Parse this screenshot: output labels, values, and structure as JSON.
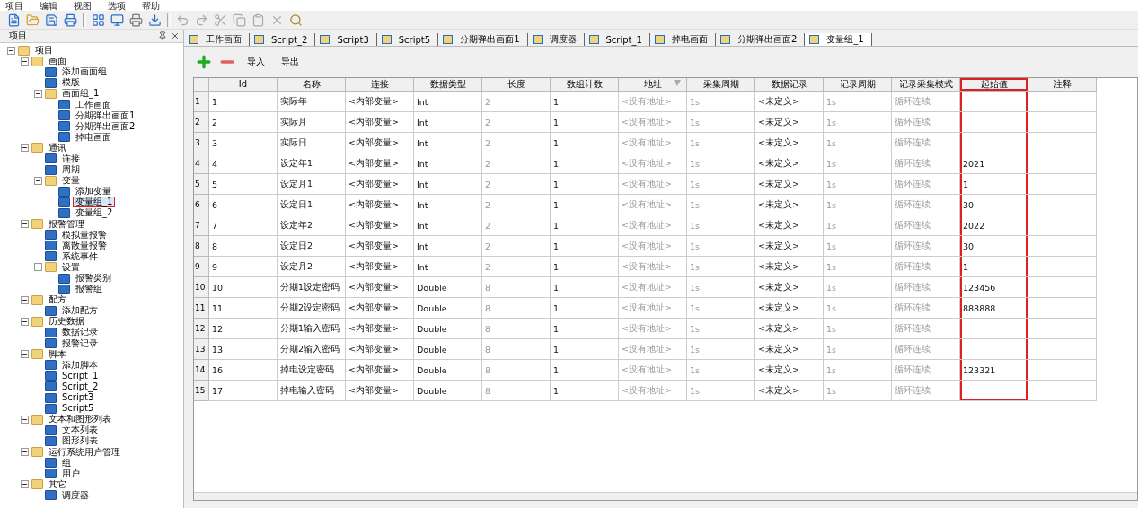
{
  "menu": [
    "项目",
    "编辑",
    "视图",
    "选项",
    "帮助"
  ],
  "sidebar": {
    "title": "项目",
    "tree": [
      {
        "label": "项目",
        "expanded": true,
        "selected": false,
        "children": [
          {
            "label": "画面",
            "expanded": true,
            "selected": false,
            "children": [
              {
                "label": "添加画面组",
                "selected": false
              },
              {
                "label": "模版",
                "selected": false
              },
              {
                "label": "画面组_1",
                "expanded": true,
                "selected": false,
                "children": [
                  {
                    "label": "工作画面",
                    "selected": false
                  },
                  {
                    "label": "分期弹出画面1",
                    "selected": false
                  },
                  {
                    "label": "分期弹出画面2",
                    "selected": false
                  },
                  {
                    "label": "掉电画面",
                    "selected": false
                  }
                ]
              }
            ]
          },
          {
            "label": "通讯",
            "expanded": true,
            "selected": false,
            "children": [
              {
                "label": "连接",
                "selected": false
              },
              {
                "label": "周期",
                "selected": false
              },
              {
                "label": "变量",
                "expanded": true,
                "selected": false,
                "children": [
                  {
                    "label": "添加变量",
                    "selected": false
                  },
                  {
                    "label": "变量组_1",
                    "selected": true,
                    "annotated": true
                  },
                  {
                    "label": "变量组_2",
                    "selected": false
                  }
                ]
              }
            ]
          },
          {
            "label": "报警管理",
            "expanded": true,
            "selected": false,
            "children": [
              {
                "label": "模拟量报警",
                "selected": false
              },
              {
                "label": "离散量报警",
                "selected": false
              },
              {
                "label": "系统事件",
                "selected": false
              },
              {
                "label": "设置",
                "expanded": true,
                "selected": false,
                "children": [
                  {
                    "label": "报警类别",
                    "selected": false
                  },
                  {
                    "label": "报警组",
                    "selected": false
                  }
                ]
              }
            ]
          },
          {
            "label": "配方",
            "expanded": true,
            "selected": false,
            "children": [
              {
                "label": "添加配方",
                "selected": false
              }
            ]
          },
          {
            "label": "历史数据",
            "expanded": true,
            "selected": false,
            "children": [
              {
                "label": "数据记录",
                "selected": false
              },
              {
                "label": "报警记录",
                "selected": false
              }
            ]
          },
          {
            "label": "脚本",
            "expanded": true,
            "selected": false,
            "children": [
              {
                "label": "添加脚本",
                "selected": false
              },
              {
                "label": "Script_1",
                "selected": false
              },
              {
                "label": "Script_2",
                "selected": false
              },
              {
                "label": "Script3",
                "selected": false
              },
              {
                "label": "Script5",
                "selected": false
              }
            ]
          },
          {
            "label": "文本和图形列表",
            "expanded": true,
            "selected": false,
            "children": [
              {
                "label": "文本列表",
                "selected": false
              },
              {
                "label": "图形列表",
                "selected": false
              }
            ]
          },
          {
            "label": "运行系统用户管理",
            "expanded": true,
            "selected": false,
            "children": [
              {
                "label": "组",
                "selected": false
              },
              {
                "label": "用户",
                "selected": false
              }
            ]
          },
          {
            "label": "其它",
            "expanded": true,
            "selected": false,
            "children": [
              {
                "label": "调度器",
                "selected": false
              }
            ]
          }
        ]
      }
    ]
  },
  "tabs": [
    {
      "label": "工作画面",
      "selected": false
    },
    {
      "label": "Script_2",
      "selected": false
    },
    {
      "label": "Script3",
      "selected": false
    },
    {
      "label": "Script5",
      "selected": false
    },
    {
      "label": "分期弹出画面1",
      "selected": false
    },
    {
      "label": "调度器",
      "selected": false
    },
    {
      "label": "Script_1",
      "selected": false
    },
    {
      "label": "掉电画面",
      "selected": false
    },
    {
      "label": "分期弹出画面2",
      "selected": false
    },
    {
      "label": "变量组_1",
      "selected": true
    }
  ],
  "actions": [
    "导入",
    "导出"
  ],
  "table": {
    "columns": [
      {
        "label": "Id",
        "muted": false,
        "annotated": false
      },
      {
        "label": "名称",
        "muted": false,
        "annotated": false
      },
      {
        "label": "连接",
        "muted": false,
        "annotated": false
      },
      {
        "label": "数据类型",
        "muted": false,
        "annotated": false
      },
      {
        "label": "长度",
        "muted": true,
        "annotated": false
      },
      {
        "label": "数组计数",
        "muted": false,
        "annotated": false
      },
      {
        "label": "地址",
        "muted": true,
        "annotated": false,
        "filter": true
      },
      {
        "label": "采集周期",
        "muted": true,
        "annotated": false
      },
      {
        "label": "数据记录",
        "muted": false,
        "annotated": false
      },
      {
        "label": "记录周期",
        "muted": true,
        "annotated": false
      },
      {
        "label": "记录采集模式",
        "muted": true,
        "annotated": false
      },
      {
        "label": "起始值",
        "muted": false,
        "annotated": true
      },
      {
        "label": "注释",
        "muted": false,
        "annotated": false
      }
    ],
    "rows": [
      {
        "num": "1",
        "cells": [
          "1",
          "实际年",
          "<内部变量>",
          "Int",
          "2",
          "1",
          "<没有地址>",
          "1s",
          "<未定义>",
          "1s",
          "循环连续",
          "",
          ""
        ]
      },
      {
        "num": "2",
        "cells": [
          "2",
          "实际月",
          "<内部变量>",
          "Int",
          "2",
          "1",
          "<没有地址>",
          "1s",
          "<未定义>",
          "1s",
          "循环连续",
          "",
          ""
        ]
      },
      {
        "num": "3",
        "cells": [
          "3",
          "实际日",
          "<内部变量>",
          "Int",
          "2",
          "1",
          "<没有地址>",
          "1s",
          "<未定义>",
          "1s",
          "循环连续",
          "",
          ""
        ]
      },
      {
        "num": "4",
        "cells": [
          "4",
          "设定年1",
          "<内部变量>",
          "Int",
          "2",
          "1",
          "<没有地址>",
          "1s",
          "<未定义>",
          "1s",
          "循环连续",
          "2021",
          ""
        ]
      },
      {
        "num": "5",
        "cells": [
          "5",
          "设定月1",
          "<内部变量>",
          "Int",
          "2",
          "1",
          "<没有地址>",
          "1s",
          "<未定义>",
          "1s",
          "循环连续",
          "1",
          ""
        ]
      },
      {
        "num": "6",
        "cells": [
          "6",
          "设定日1",
          "<内部变量>",
          "Int",
          "2",
          "1",
          "<没有地址>",
          "1s",
          "<未定义>",
          "1s",
          "循环连续",
          "30",
          ""
        ]
      },
      {
        "num": "7",
        "cells": [
          "7",
          "设定年2",
          "<内部变量>",
          "Int",
          "2",
          "1",
          "<没有地址>",
          "1s",
          "<未定义>",
          "1s",
          "循环连续",
          "2022",
          ""
        ]
      },
      {
        "num": "8",
        "cells": [
          "8",
          "设定日2",
          "<内部变量>",
          "Int",
          "2",
          "1",
          "<没有地址>",
          "1s",
          "<未定义>",
          "1s",
          "循环连续",
          "30",
          ""
        ]
      },
      {
        "num": "9",
        "cells": [
          "9",
          "设定月2",
          "<内部变量>",
          "Int",
          "2",
          "1",
          "<没有地址>",
          "1s",
          "<未定义>",
          "1s",
          "循环连续",
          "1",
          ""
        ]
      },
      {
        "num": "10",
        "cells": [
          "10",
          "分期1设定密码",
          "<内部变量>",
          "Double",
          "8",
          "1",
          "<没有地址>",
          "1s",
          "<未定义>",
          "1s",
          "循环连续",
          "123456",
          ""
        ]
      },
      {
        "num": "11",
        "cells": [
          "11",
          "分期2设定密码",
          "<内部变量>",
          "Double",
          "8",
          "1",
          "<没有地址>",
          "1s",
          "<未定义>",
          "1s",
          "循环连续",
          "888888",
          ""
        ]
      },
      {
        "num": "12",
        "cells": [
          "12",
          "分期1输入密码",
          "<内部变量>",
          "Double",
          "8",
          "1",
          "<没有地址>",
          "1s",
          "<未定义>",
          "1s",
          "循环连续",
          "",
          ""
        ]
      },
      {
        "num": "13",
        "cells": [
          "13",
          "分期2输入密码",
          "<内部变量>",
          "Double",
          "8",
          "1",
          "<没有地址>",
          "1s",
          "<未定义>",
          "1s",
          "循环连续",
          "",
          ""
        ]
      },
      {
        "num": "14",
        "cells": [
          "16",
          "掉电设定密码",
          "<内部变量>",
          "Double",
          "8",
          "1",
          "<没有地址>",
          "1s",
          "<未定义>",
          "1s",
          "循环连续",
          "123321",
          ""
        ]
      },
      {
        "num": "15",
        "cells": [
          "17",
          "掉电输入密码",
          "<内部变量>",
          "Double",
          "8",
          "1",
          "<没有地址>",
          "1s",
          "<未定义>",
          "1s",
          "循环连续",
          "",
          ""
        ]
      }
    ]
  }
}
